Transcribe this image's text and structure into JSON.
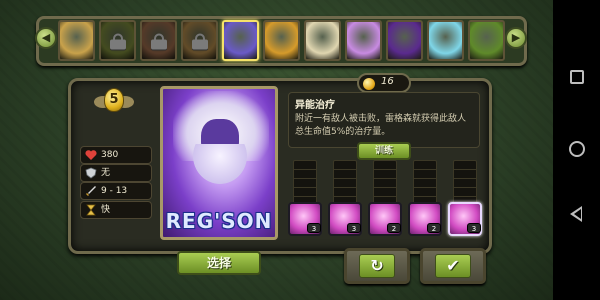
{
  "hero_strip": {
    "heroes": [
      {
        "name": "hero-1",
        "locked": false,
        "selected": false,
        "color": "#c9a24b"
      },
      {
        "name": "hero-2",
        "locked": true,
        "selected": false,
        "color": "#7c8a3a"
      },
      {
        "name": "hero-3",
        "locked": true,
        "selected": false,
        "color": "#9c6a4a"
      },
      {
        "name": "hero-4",
        "locked": true,
        "selected": false,
        "color": "#b38a4a"
      },
      {
        "name": "regson",
        "locked": false,
        "selected": true,
        "color": "#6a5ac8"
      },
      {
        "name": "hero-6",
        "locked": false,
        "selected": false,
        "color": "#d69b2b"
      },
      {
        "name": "hero-7",
        "locked": false,
        "selected": false,
        "color": "#e0d6b0"
      },
      {
        "name": "hero-8",
        "locked": false,
        "selected": false,
        "color": "#c88be2"
      },
      {
        "name": "hero-9",
        "locked": false,
        "selected": false,
        "color": "#5a2a8e"
      },
      {
        "name": "hero-10",
        "locked": false,
        "selected": false,
        "color": "#7fd6e8"
      },
      {
        "name": "hero-11",
        "locked": false,
        "selected": false,
        "color": "#5f8a2a"
      }
    ],
    "left_arrow": "◀",
    "right_arrow": "▶"
  },
  "hero": {
    "level": "5",
    "portrait_name": "REG'SON",
    "stats": {
      "hp": "380",
      "armor": "无",
      "damage": "9 - 13",
      "speed": "快"
    },
    "icons": {
      "hp": "heart-icon",
      "armor": "shield-icon",
      "damage": "sword-icon",
      "speed": "hourglass-icon"
    }
  },
  "currency": {
    "value": "16"
  },
  "skill": {
    "title": "异能治疗",
    "description": "附近一有敌人被击败，雷格森就获得此敌人总生命值5%的治疗量。"
  },
  "buttons": {
    "train": "训练",
    "select": "选择",
    "undo": "↻",
    "confirm": "✔"
  },
  "skills": [
    {
      "name": "skill-1",
      "badge": "3",
      "selected": false
    },
    {
      "name": "skill-2",
      "badge": "3",
      "selected": false
    },
    {
      "name": "skill-3",
      "badge": "2",
      "selected": false
    },
    {
      "name": "skill-4",
      "badge": "2",
      "selected": false
    },
    {
      "name": "skill-5",
      "badge": "3",
      "selected": true
    }
  ],
  "navigation": {
    "recents": "recents-icon",
    "home": "home-icon",
    "back": "back-icon"
  }
}
